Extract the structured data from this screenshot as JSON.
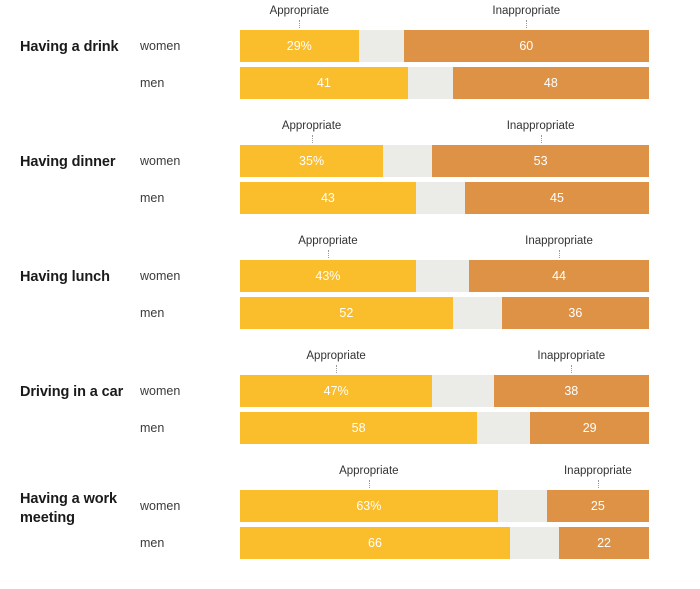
{
  "chart_data": {
    "type": "bar",
    "subtype": "diverging-stacked-bar",
    "title": "",
    "subtitle": "",
    "xlabel": "",
    "ylabel": "",
    "xlim": [
      0,
      100
    ],
    "grid": false,
    "legend_position": "top",
    "column_headers": [
      "Appropriate",
      "Inappropriate"
    ],
    "series": [
      {
        "name": "Appropriate",
        "color": "#fabd2b"
      },
      {
        "name": "Inappropriate",
        "color": "#dd9245"
      }
    ],
    "neutral_color": "#ebebe7",
    "categories": [
      "Having a drink",
      "Having dinner",
      "Having lunch",
      "Driving in a car",
      "Having a work meeting"
    ],
    "groups": [
      {
        "category": "Having a drink",
        "rows": [
          {
            "label": "women",
            "appropriate": 29,
            "appropriate_text": "29%",
            "inappropriate": 60,
            "inappropriate_text": "60"
          },
          {
            "label": "men",
            "appropriate": 41,
            "appropriate_text": "41",
            "inappropriate": 48,
            "inappropriate_text": "48"
          }
        ]
      },
      {
        "category": "Having dinner",
        "rows": [
          {
            "label": "women",
            "appropriate": 35,
            "appropriate_text": "35%",
            "inappropriate": 53,
            "inappropriate_text": "53"
          },
          {
            "label": "men",
            "appropriate": 43,
            "appropriate_text": "43",
            "inappropriate": 45,
            "inappropriate_text": "45"
          }
        ]
      },
      {
        "category": "Having lunch",
        "rows": [
          {
            "label": "women",
            "appropriate": 43,
            "appropriate_text": "43%",
            "inappropriate": 44,
            "inappropriate_text": "44"
          },
          {
            "label": "men",
            "appropriate": 52,
            "appropriate_text": "52",
            "inappropriate": 36,
            "inappropriate_text": "36"
          }
        ]
      },
      {
        "category": "Driving in a car",
        "rows": [
          {
            "label": "women",
            "appropriate": 47,
            "appropriate_text": "47%",
            "inappropriate": 38,
            "inappropriate_text": "38"
          },
          {
            "label": "men",
            "appropriate": 58,
            "appropriate_text": "58",
            "inappropriate": 29,
            "inappropriate_text": "29"
          }
        ]
      },
      {
        "category": "Having a work meeting",
        "rows": [
          {
            "label": "women",
            "appropriate": 63,
            "appropriate_text": "63%",
            "inappropriate": 25,
            "inappropriate_text": "25"
          },
          {
            "label": "men",
            "appropriate": 66,
            "appropriate_text": "66",
            "inappropriate": 22,
            "inappropriate_text": "22"
          }
        ]
      }
    ]
  }
}
